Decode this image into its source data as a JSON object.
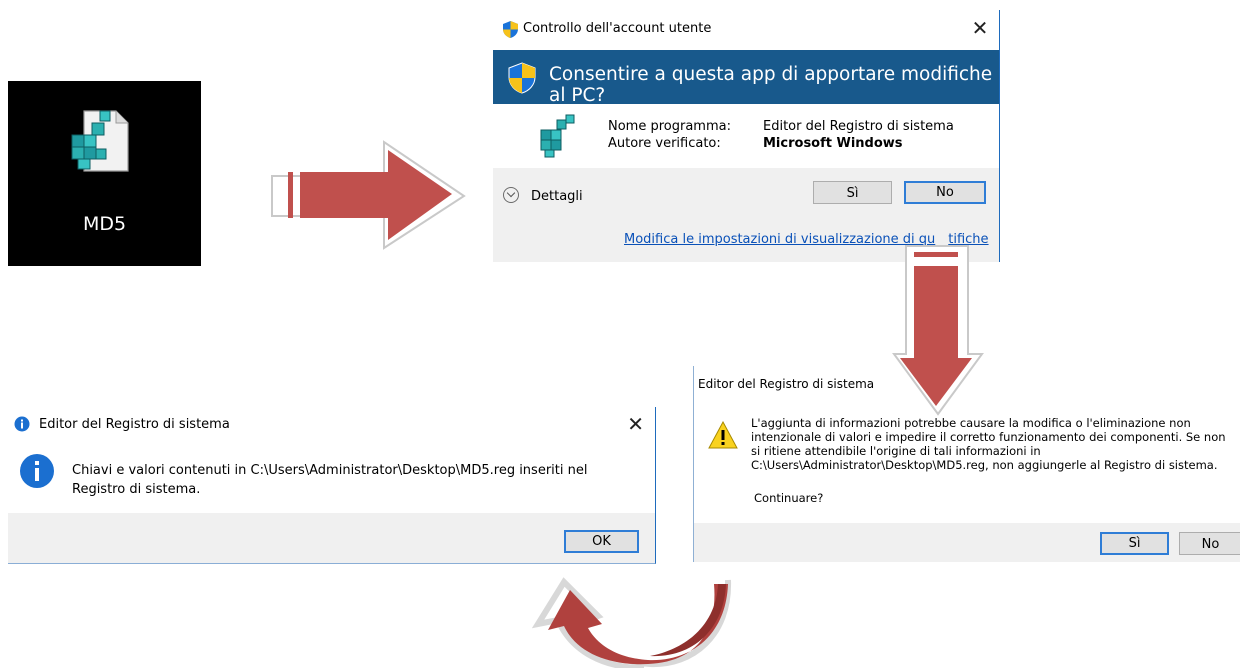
{
  "desktop": {
    "file_label": "MD5",
    "icon": "registry-file-icon"
  },
  "uac": {
    "title": "Controllo dell'account utente",
    "title_icon": "shield-icon",
    "close_glyph": "✕",
    "question": "Consentire a questa app di apportare modifiche al PC?",
    "program_label": "Nome programma:",
    "program_value": "Editor del Registro di sistema",
    "publisher_label": "Autore verificato:",
    "publisher_value": "Microsoft Windows",
    "details_label": "Dettagli",
    "yes_label": "Sì",
    "no_label": "No",
    "settings_link": "Modifica le impostazioni di visualizzazione di qu",
    "settings_link_tail": "tifiche"
  },
  "warning": {
    "title": "Editor del Registro di sistema",
    "icon": "warning-icon",
    "message": "L'aggiunta di informazioni potrebbe causare la modifica o l'eliminazione non intenzionale di valori e impedire il corretto funzionamento dei componenti. Se non si ritiene attendibile l'origine di tali informazioni in C:\\Users\\Administrator\\Desktop\\MD5.reg, non aggiungerle al Registro di sistema.",
    "prompt": "Continuare?",
    "yes_label": "Sì",
    "no_label": "No"
  },
  "info": {
    "title": "Editor del Registro di sistema",
    "icon": "info-icon",
    "close_glyph": "✕",
    "message": "Chiavi e valori contenuti in C:\\Users\\Administrator\\Desktop\\MD5.reg inseriti nel Registro di sistema.",
    "ok_label": "OK"
  },
  "colors": {
    "uac_banner": "#18598c",
    "arrow_fill": "#c0504d",
    "accent_border": "#2f7dd6"
  }
}
